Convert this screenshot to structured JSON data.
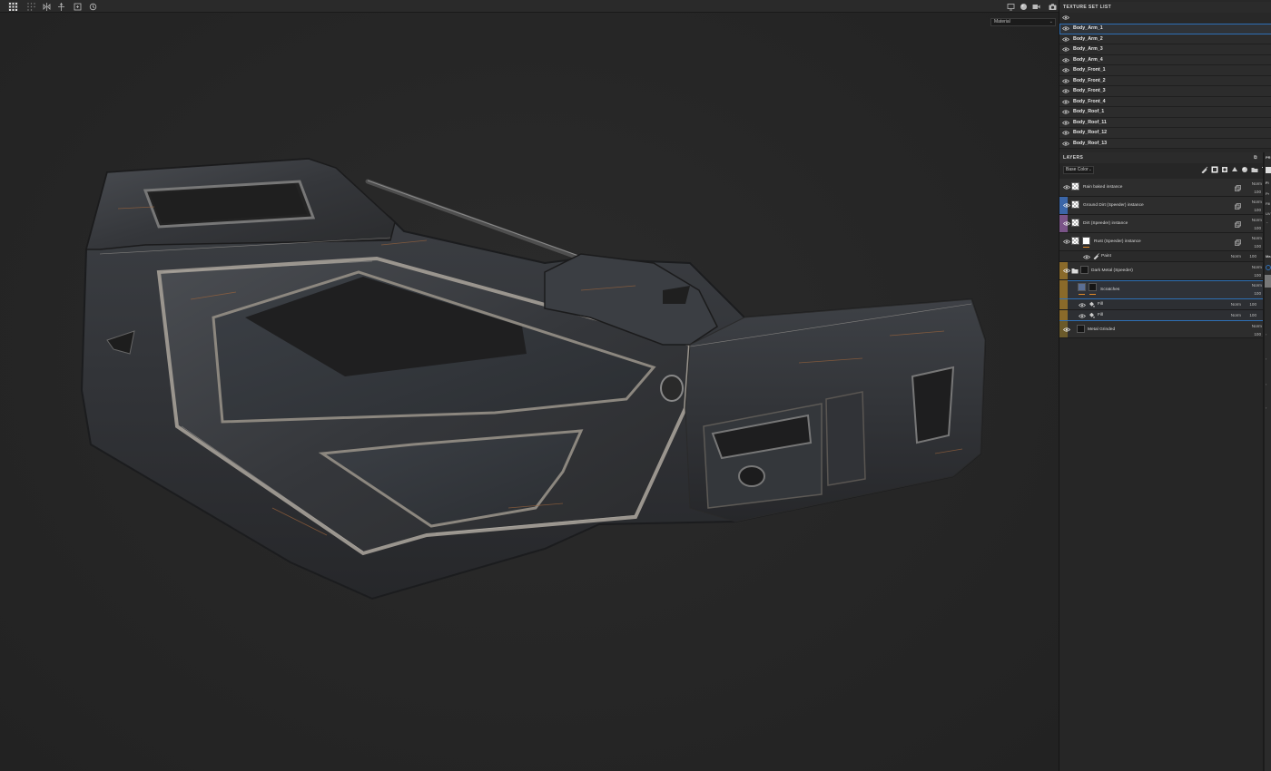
{
  "viewport": {
    "dropdown_value": "Material"
  },
  "texture_set_list": {
    "title": "TEXTURE SET LIST",
    "items": [
      {
        "label": "Body_Arm_1",
        "selected": true
      },
      {
        "label": "Body_Arm_2"
      },
      {
        "label": "Body_Arm_3"
      },
      {
        "label": "Body_Arm_4"
      },
      {
        "label": "Body_Front_1"
      },
      {
        "label": "Body_Front_2"
      },
      {
        "label": "Body_Front_3"
      },
      {
        "label": "Body_Front_4"
      },
      {
        "label": "Body_Roof_1"
      },
      {
        "label": "Body_Roof_11"
      },
      {
        "label": "Body_Roof_12"
      },
      {
        "label": "Body_Roof_13"
      }
    ]
  },
  "layers": {
    "title": "LAYERS",
    "channel": "Base Color",
    "rows": [
      {
        "name": "Rain baked instance",
        "blend": "Norm",
        "opacity": "100",
        "color": "",
        "thumb": "checker",
        "indent": 0
      },
      {
        "name": "Ground Dirt (Speeder) instance",
        "blend": "Norm",
        "opacity": "100",
        "color": "#3b66a8",
        "thumb": "checker",
        "indent": 0
      },
      {
        "name": "Dirt (Speeder) instance",
        "blend": "Norm",
        "opacity": "100",
        "color": "#7a5488",
        "thumb": "checker",
        "indent": 0
      },
      {
        "name": "Rust (Speeder) instance",
        "blend": "Norm",
        "opacity": "100",
        "color": "",
        "thumb": "checker",
        "indent": 0
      },
      {
        "name": "Paint",
        "blend": "Norm",
        "opacity": "100",
        "color": "",
        "thumb": "brush",
        "indent": 1
      },
      {
        "name": "Dark Metal (Speeder)",
        "blend": "Norm",
        "opacity": "100",
        "color": "#8a6a2a",
        "thumb": "folder",
        "indent": 0
      },
      {
        "name": "Scratches",
        "blend": "Norm",
        "opacity": "100",
        "color": "#8a6a2a",
        "thumb": "image",
        "indent": 1
      },
      {
        "name": "Fill",
        "blend": "Norm",
        "opacity": "100",
        "color": "",
        "thumb": "fill",
        "indent": 2
      },
      {
        "name": "Fill",
        "blend": "Norm",
        "opacity": "100",
        "color": "",
        "thumb": "fill",
        "indent": 2
      },
      {
        "name": "Metal Grinded",
        "blend": "Norm",
        "opacity": "100",
        "color": "#6b5a2a",
        "thumb": "mask",
        "indent": 0
      }
    ]
  },
  "right_strip": {
    "labels": [
      "PR",
      "Fi",
      "Pr",
      "Fill",
      "UV",
      "Ma"
    ]
  },
  "toolbar_icons": [
    "grid-icon",
    "dots-grid-icon",
    "mirror-icon",
    "symmetry-icon",
    "frame-icon",
    "history-icon"
  ],
  "right_toolbar_icons": [
    "display-icon",
    "sphere-icon",
    "video-icon",
    "camera-icon"
  ]
}
